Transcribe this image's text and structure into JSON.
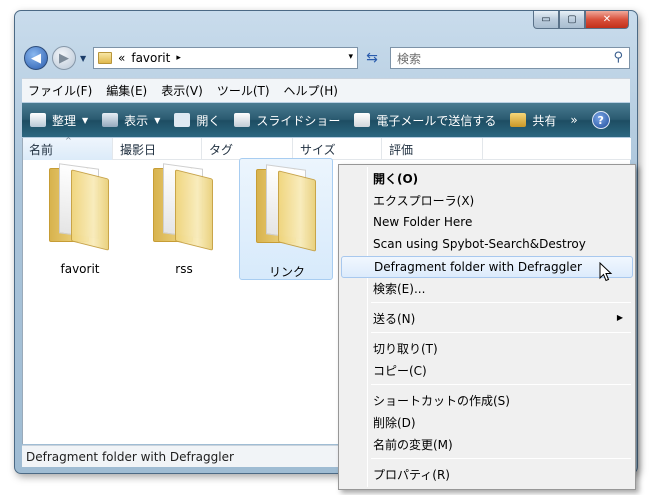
{
  "window": {
    "buttons": {
      "minimize": "▭",
      "maximize": "▢",
      "close": "✕"
    }
  },
  "address_bar": {
    "prefix": "«",
    "path": "favorit",
    "separator": "▸",
    "dropdown": "▾"
  },
  "search": {
    "placeholder": "検索"
  },
  "menu": [
    "ファイル(F)",
    "編集(E)",
    "表示(V)",
    "ツール(T)",
    "ヘルプ(H)"
  ],
  "toolbar": {
    "organize": "整理",
    "views": "表示",
    "open": "開く",
    "slideshow": "スライドショー",
    "email": "電子メールで送信する",
    "share": "共有",
    "more": "»",
    "help": "?"
  },
  "columns": {
    "name": "名前",
    "date_taken": "撮影日",
    "tags": "タグ",
    "size": "サイズ",
    "rating": "評価"
  },
  "items": [
    {
      "label": "favorit"
    },
    {
      "label": "rss"
    },
    {
      "label": "リンク",
      "selected": true
    }
  ],
  "status_bar": {
    "text": "Defragment folder with Defraggler"
  },
  "context_menu": {
    "items": [
      "開く(O)",
      "エクスプローラ(X)",
      "New Folder Here",
      "Scan using Spybot-Search&Destroy",
      "Defragment folder with Defraggler",
      "検索(E)...",
      "送る(N)",
      "切り取り(T)",
      "コピー(C)",
      "ショートカットの作成(S)",
      "削除(D)",
      "名前の変更(M)",
      "プロパティ(R)"
    ],
    "highlighted": "Defragment folder with Defraggler",
    "submenu_arrow": "▶"
  },
  "colors": {
    "cmdbar": "#2a5a70",
    "selection": "#d7eafb",
    "menu_bg": "#f0f0f0"
  }
}
